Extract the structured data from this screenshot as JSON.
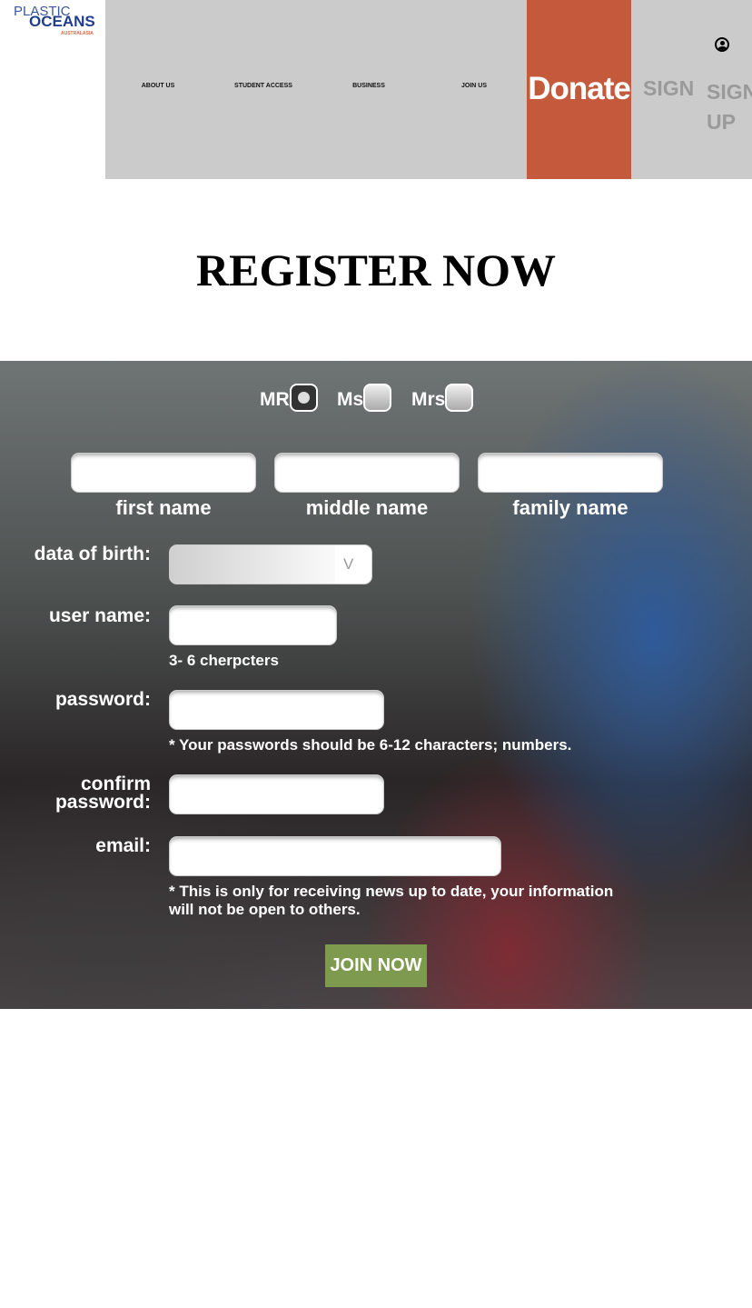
{
  "logo": {
    "line1": "PLASTIC",
    "line2": "OCEANS",
    "line3": "AUSTRALASIA"
  },
  "nav": {
    "items": [
      "ABOUT US",
      "STUDENT ACCESS",
      "BUSINESS",
      "JOIN US"
    ],
    "donate": "Donate",
    "sign_in": "SIGN",
    "sign_up_1": "SIGN",
    "sign_up_2": "UP"
  },
  "title": "REGISTER NOW",
  "form": {
    "titles": [
      "MR",
      "Ms",
      "Mrs"
    ],
    "selected_title": "MR",
    "name_labels": [
      "first name",
      "middle name",
      "family name"
    ],
    "dob_label": "data of birth:",
    "dob_arrow": "V",
    "username_label": "user name:",
    "username_hint": "3- 6 cherpcters",
    "password_label": "password:",
    "password_hint": "* Your passwords should be 6-12 characters;   numbers.",
    "confirm_label_1": "confirm",
    "confirm_label_2": "password:",
    "email_label": "email:",
    "email_note_1": "* This is only for receiving news up to date, your information",
    "email_note_2": "will not be open to others.",
    "submit": "JOIN NOW"
  }
}
